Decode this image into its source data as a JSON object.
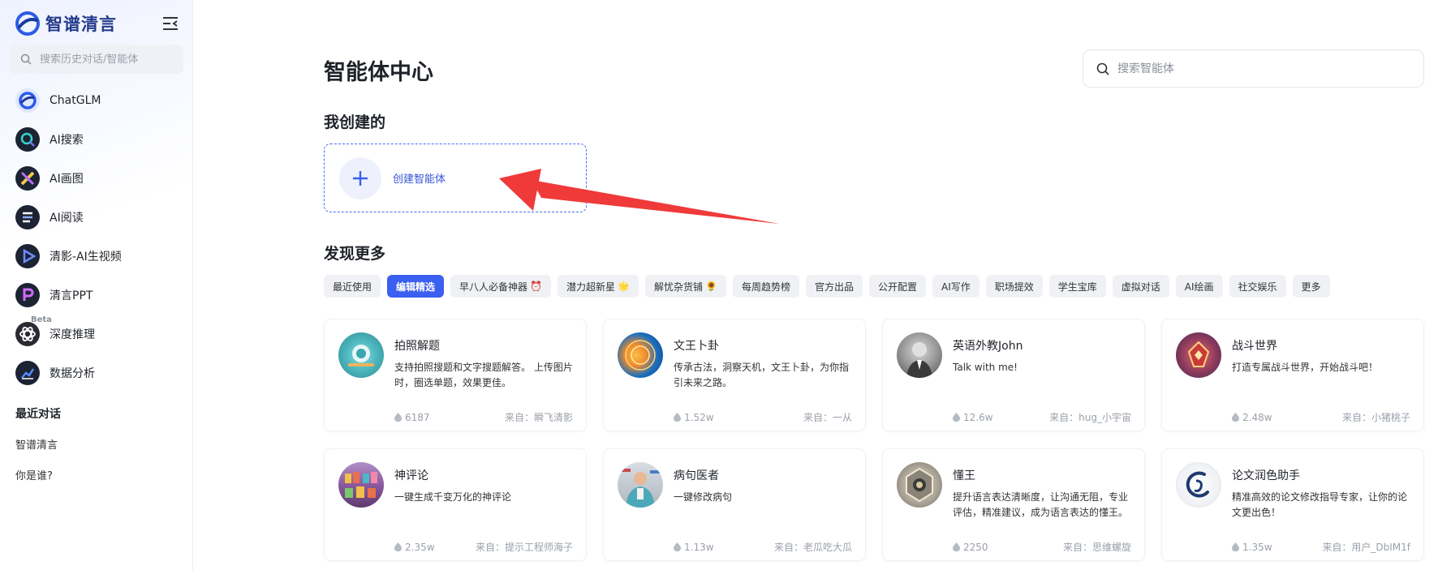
{
  "brand": {
    "name": "智谱清言"
  },
  "sidebar": {
    "search_placeholder": "搜索历史对话/智能体",
    "items": [
      {
        "label": "ChatGLM",
        "icon": "chatglm-icon"
      },
      {
        "label": "AI搜索",
        "icon": "ai-search-icon"
      },
      {
        "label": "AI画图",
        "icon": "ai-draw-icon"
      },
      {
        "label": "AI阅读",
        "icon": "ai-read-icon"
      },
      {
        "label": "清影-AI生视频",
        "icon": "video-icon"
      },
      {
        "label": "清言PPT",
        "icon": "ppt-icon"
      },
      {
        "label": "深度推理",
        "icon": "reasoning-icon",
        "badge": "Beta"
      },
      {
        "label": "数据分析",
        "icon": "data-analysis-icon"
      }
    ],
    "recent_title": "最近对话",
    "recent": [
      "智谱清言",
      "你是谁?"
    ]
  },
  "main": {
    "title": "智能体中心",
    "search_placeholder": "搜索智能体",
    "my_created_title": "我创建的",
    "create_label": "创建智能体",
    "discover_title": "发现更多",
    "tabs": [
      {
        "label": "最近使用"
      },
      {
        "label": "编辑精选",
        "active": true
      },
      {
        "label": "早八人必备神器",
        "emoji": "⏰"
      },
      {
        "label": "潜力超新星",
        "emoji": "🌟"
      },
      {
        "label": "解忧杂货铺",
        "emoji": "🌻"
      },
      {
        "label": "每周趋势榜"
      },
      {
        "label": "官方出品"
      },
      {
        "label": "公开配置"
      },
      {
        "label": "AI写作"
      },
      {
        "label": "职场提效"
      },
      {
        "label": "学生宝库"
      },
      {
        "label": "虚拟对话"
      },
      {
        "label": "AI绘画"
      },
      {
        "label": "社交娱乐"
      },
      {
        "label": "更多"
      }
    ],
    "cards": [
      {
        "title": "拍照解题",
        "desc": "支持拍照搜题和文字搜题解答。 上传图片时，圈选单题，效果更佳。",
        "count": "6187",
        "from": "来自：瞬飞清影"
      },
      {
        "title": "文王卜卦",
        "desc": "传承古法，洞察天机，文王卜卦，为你指引未来之路。",
        "count": "1.52w",
        "from": "来自：一从"
      },
      {
        "title": "英语外教John",
        "desc": "Talk with me!",
        "count": "12.6w",
        "from": "来自：hug_小宇宙"
      },
      {
        "title": "战斗世界",
        "desc": "打造专属战斗世界，开始战斗吧！",
        "count": "2.48w",
        "from": "来自：小猪桃子"
      },
      {
        "title": "神评论",
        "desc": "一键生成千变万化的神评论",
        "count": "2.35w",
        "from": "来自：提示工程师海子"
      },
      {
        "title": "病句医者",
        "desc": "一键修改病句",
        "count": "1.13w",
        "from": "来自：老瓜吃大瓜"
      },
      {
        "title": "懂王",
        "desc": "提升语言表达清晰度，让沟通无阻，专业评估，精准建议，成为语言表达的懂王。",
        "count": "2250",
        "from": "来自：思维螺旋"
      },
      {
        "title": "论文润色助手",
        "desc": "精准高效的论文修改指导专家，让你的论文更出色！",
        "count": "1.35w",
        "from": "来自：用户_DbIM1f"
      }
    ]
  },
  "colors": {
    "accent": "#3b5ff0",
    "arrow": "#f03a3a",
    "brand": "#243b8c"
  }
}
